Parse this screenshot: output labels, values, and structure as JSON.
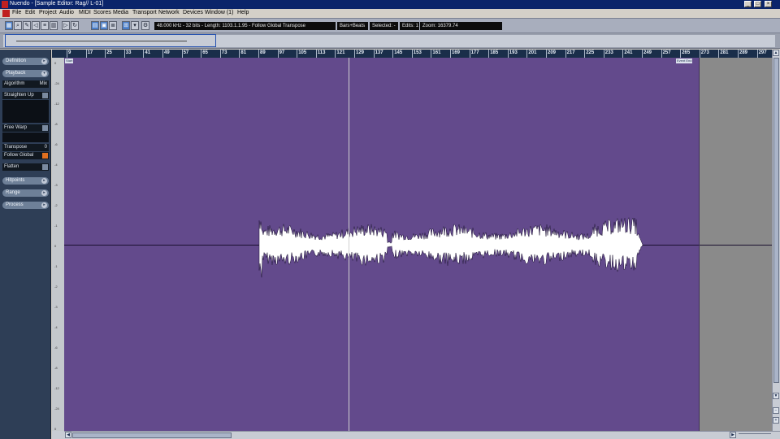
{
  "window": {
    "title": "Nuendo - [Sample Editor: Rag// L-01]",
    "buttons": {
      "minimize": "_",
      "maximize": "□",
      "close": "×"
    }
  },
  "menu": [
    "File",
    "Edit",
    "Project",
    "Audio",
    "MIDI",
    "Scores",
    "Media",
    "Transport",
    "Network",
    "Devices",
    "Window (1)",
    "Help"
  ],
  "toolbar": {
    "info": "48.000 kHz - 32 bits - Length: 1103.1.1.95 - Follow Global Transpose",
    "format": "Bars+Beats",
    "selected": "Selected: -",
    "edits": "Edits: 1",
    "zoom": "Zoom: 16379.74"
  },
  "ruler": {
    "ticks": [
      "9",
      "17",
      "25",
      "33",
      "41",
      "49",
      "57",
      "65",
      "73",
      "81",
      "89",
      "97",
      "105",
      "113",
      "121",
      "129",
      "137",
      "145",
      "153",
      "161",
      "169",
      "177",
      "185",
      "193",
      "201",
      "209",
      "217",
      "225",
      "233",
      "241",
      "249",
      "257",
      "265",
      "273",
      "281",
      "289",
      "297"
    ],
    "start_marker": "Start",
    "end_marker": "Event End"
  },
  "inspector": {
    "definition": "Definition",
    "playback": "Playback",
    "algorithm_label": "Algorithm",
    "algorithm_value": "Mix",
    "straighten_up": "Straighten Up",
    "free_warp": "Free Warp",
    "transpose_label": "Transpose",
    "transpose_value": "0",
    "follow_global": "Follow Global",
    "flatten": "Flatten",
    "hitpoints": "Hitpoints",
    "range": "Range",
    "process": "Process"
  },
  "scale_labels": [
    "0",
    "-24",
    "-12",
    "-8",
    "-6",
    "-4",
    "-3",
    "-2",
    "-1",
    "0",
    "-1",
    "-2",
    "-3",
    "-4",
    "-6",
    "-8",
    "-12",
    "-24",
    "0"
  ],
  "colors": {
    "waveform_bg": "#634a8c",
    "waveform": "#ffffff",
    "ruler_bg": "#1a2e4a",
    "inspector_bg": "#2e3e56"
  }
}
